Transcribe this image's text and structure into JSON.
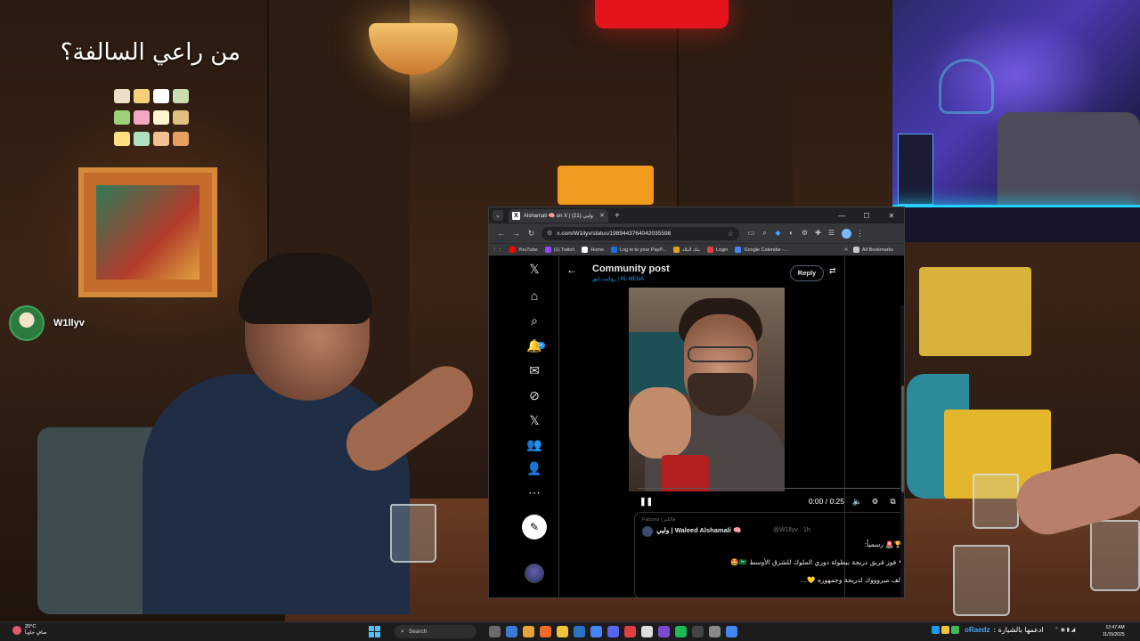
{
  "stream": {
    "overlay_title": "من راعي السالفة؟",
    "streamer_name": "W1llyv"
  },
  "browser": {
    "tab_title": "Alshamali 🧠 on X | (21) وليي",
    "new_tab": "+",
    "url": "x.com/W1llyv/status/1989443764042035598",
    "bookmarks": [
      {
        "label": "YouTube",
        "color": "#ff0000"
      },
      {
        "label": "(1) Twitch",
        "color": "#9146ff"
      },
      {
        "label": "Home",
        "color": "#ffffff"
      },
      {
        "label": "Log in to your PayP...",
        "color": "#1d6fe0"
      },
      {
        "label": "بنك البلاد",
        "color": "#e0a020"
      },
      {
        "label": "Login",
        "color": "#e04040"
      },
      {
        "label": "Google Calendar -...",
        "color": "#4285f4"
      }
    ],
    "all_bookmarks": "All Bookmarks",
    "more": "»"
  },
  "x": {
    "header_title": "Community post",
    "header_subtitle": "روكيت ليق | RL MENA",
    "reply_button": "Reply",
    "nav_badge": "20+",
    "video": {
      "time": "0:00 / 0:25",
      "progress": 0
    },
    "quote": {
      "context": "Falcons | فالكنز",
      "author": "وليي | Waleed Alshamali 🧠",
      "handle": "@W1llyv · 1h",
      "line1": "🏆🚨 رسمياً:",
      "line2": "• فوز فريق دريجة ببطولة دوري الملوك للشرق الأوسط 🇸🇦🤩",
      "line3": "ألف مبروووك لدريجة وجمهوره 💛..."
    }
  },
  "taskbar": {
    "weather_temp": "20°C",
    "weather_desc": "صافٍ جاوياً",
    "search_label": "Search",
    "tray_user": "oRaedz",
    "tray_text": "ادعمها بالشيارة :",
    "time": "12:47 AM",
    "date": "11/15/2025"
  },
  "colors": {
    "x_accent": "#1d9bf0",
    "windows_accent": "#4cc2ff"
  }
}
